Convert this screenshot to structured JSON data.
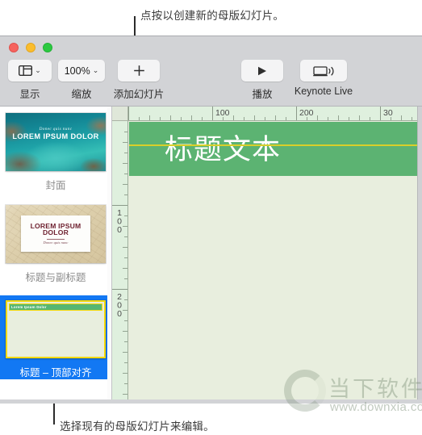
{
  "callouts": {
    "top": "点按以创建新的母版幻灯片。",
    "bottom": "选择现有的母版幻灯片来编辑。"
  },
  "window": {
    "traffic_lights": {
      "close": "close-button",
      "minimize": "minimize-button",
      "zoom": "zoom-button"
    }
  },
  "toolbar": {
    "view": {
      "label": "显示",
      "icon": "view-panel-icon",
      "chevron": "⌄"
    },
    "zoom": {
      "label": "缩放",
      "value": "100%",
      "chevron": "⌄"
    },
    "add_slide": {
      "label": "添加幻灯片",
      "icon": "plus-icon"
    },
    "play": {
      "label": "播放",
      "icon": "play-triangle-icon"
    },
    "keynote_live": {
      "label": "Keynote Live",
      "icon": "display-broadcast-icon"
    }
  },
  "sidebar": {
    "slides": [
      {
        "caption": "封面",
        "selected": false,
        "preview": {
          "kind": "photo-ocean",
          "subtitle": "Donec quis nunc",
          "title": "LOREM IPSUM DOLOR"
        }
      },
      {
        "caption": "标题与副标题",
        "selected": false,
        "preview": {
          "kind": "photo-map",
          "title": "LOREM IPSUM DOLOR",
          "subtitle": "Donec quis nunc"
        }
      },
      {
        "caption": "标题 – 顶部对齐",
        "selected": true,
        "preview": {
          "kind": "green-title-top",
          "bar_text": "Lorem Ipsum Dolor"
        }
      }
    ]
  },
  "canvas": {
    "title_placeholder": "标题文本",
    "ruler_h_labels": [
      "100",
      "200",
      "30"
    ],
    "ruler_v_labels": [
      "100",
      "200"
    ],
    "colors": {
      "title_band": "#5cb372",
      "slide_background": "#e8eede",
      "guide_line": "#d8cf2a",
      "selection_blue": "#1278f3",
      "ruler": "#dff0de"
    }
  },
  "watermark": {
    "name": "当下软件园",
    "url": "www.downxia.com"
  }
}
